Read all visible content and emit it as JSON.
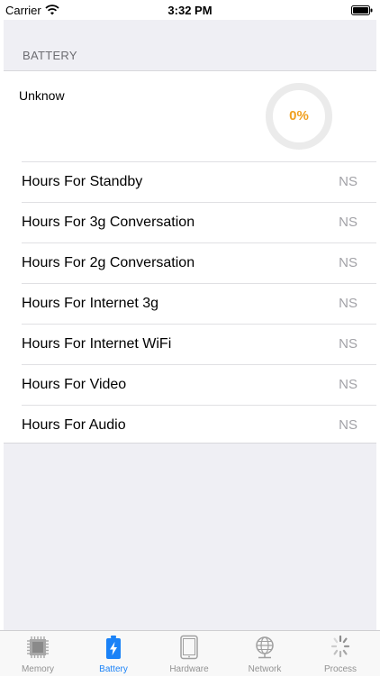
{
  "status_bar": {
    "carrier": "Carrier",
    "time": "3:32 PM"
  },
  "battery": {
    "section_title": "BATTERY",
    "state_label": "Unknow",
    "percent_text": "0%",
    "percent": 0,
    "accent_color": "#f0a020",
    "rows": [
      {
        "label": "Hours For Standby",
        "value": "NS"
      },
      {
        "label": "Hours For 3g Conversation",
        "value": "NS"
      },
      {
        "label": "Hours For 2g Conversation",
        "value": "NS"
      },
      {
        "label": "Hours For Internet 3g",
        "value": "NS"
      },
      {
        "label": "Hours For Internet WiFi",
        "value": "NS"
      },
      {
        "label": "Hours For Video",
        "value": "NS"
      },
      {
        "label": "Hours For Audio",
        "value": "NS"
      }
    ]
  },
  "tab_bar": {
    "active_color": "#1a82f7",
    "tabs": [
      {
        "label": "Memory",
        "icon": "chip-icon",
        "active": false
      },
      {
        "label": "Battery",
        "icon": "battery-icon",
        "active": true
      },
      {
        "label": "Hardware",
        "icon": "tablet-icon",
        "active": false
      },
      {
        "label": "Network",
        "icon": "globe-icon",
        "active": false
      },
      {
        "label": "Process",
        "icon": "spinner-icon",
        "active": false
      }
    ]
  }
}
